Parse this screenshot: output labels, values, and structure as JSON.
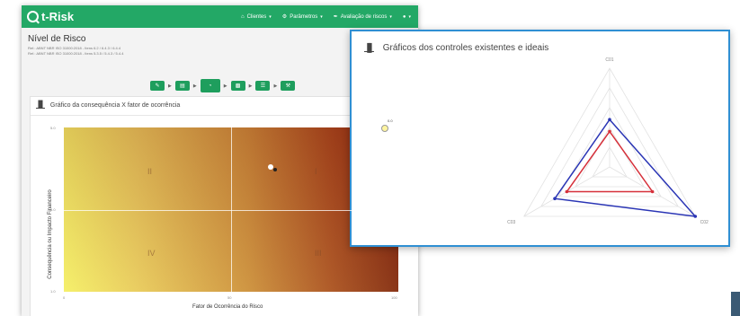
{
  "app": {
    "logo": "t-Risk",
    "nav": [
      {
        "label": "Clientes",
        "icon": "home-icon"
      },
      {
        "label": "Parâmetros",
        "icon": "gear-icon"
      },
      {
        "label": "Avaliação de riscos",
        "icon": "wrench-icon"
      },
      {
        "label": "",
        "icon": "user-icon"
      }
    ],
    "page_title": "Nível de Risco",
    "ref1": "Ref.: ABNT NBR ISO 31000:2018 - Itens 6.2 / 6.4.3 / 6.4.4",
    "ref2": "Ref.: ABNT NBR ISO 31000:2018 - Itens 5.3.5 / 5.4.3 / 5.4.4",
    "steps": [
      "pencil-icon",
      "document-icon",
      "pie-icon",
      "car-icon",
      "list-icon",
      "gavel-icon"
    ],
    "active_step": 2,
    "accent": "#23a866"
  },
  "chart_panel": {
    "title": "Gráfico da consequência X fator de ocorrência",
    "icon": "bar-chart-icon"
  },
  "chart_data": [
    {
      "type": "scatter",
      "title": "Gráfico da consequência X fator de ocorrência",
      "xlabel": "Fator de Ocorrência do Risco",
      "ylabel": "Consequência ou Impacto Financeiro",
      "xlim": [
        0,
        100
      ],
      "ylim": [
        1.0,
        5.0
      ],
      "x_ticks": [
        "0",
        "50",
        "100"
      ],
      "y_ticks": [
        "5.0",
        "3.0",
        "1.0"
      ],
      "quadrants": [
        "I",
        "II",
        "III",
        "IV"
      ],
      "points": [
        {
          "x": 47,
          "y": 4.1,
          "color": "#ffffff"
        },
        {
          "x": 50,
          "y": 4.0,
          "color": "#222222"
        },
        {
          "x": 100,
          "y": 5.0,
          "color": "#fff5a0",
          "label": "0.0"
        }
      ]
    },
    {
      "type": "radar",
      "title": "Gráficos dos controles existentes e ideais",
      "axes": [
        "C01",
        "C02",
        "C03"
      ],
      "rmax": 5,
      "series": [
        {
          "color": "#d6303a",
          "values": [
            1.8,
            2.5,
            2.5
          ]
        },
        {
          "color": "#2a35b5",
          "values": [
            2.4,
            5.0,
            3.2
          ]
        }
      ]
    }
  ],
  "radar_panel": {
    "title": "Gráficos dos controles existentes e ideais",
    "icon": "bar-chart-icon"
  }
}
